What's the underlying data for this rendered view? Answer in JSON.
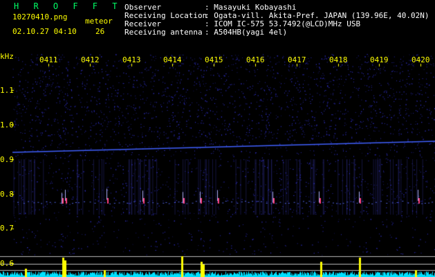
{
  "header": {
    "app_name": "H R O F F T",
    "filename": "10270410.png",
    "datetime": "02.10.27 04:10",
    "meteor_label": "meteor",
    "meteor_count": "26",
    "fields": [
      {
        "label": "Observer",
        "value": ": Masayuki Kobayashi"
      },
      {
        "label": "Receiving Location",
        "value": ": Ogata-vill. Akita-Pref. JAPAN (139.96E, 40.02N)"
      },
      {
        "label": "Receiver",
        "value": ": ICOM IC-575 53.7492(@LCD)MHz USB"
      },
      {
        "label": "Receiving antenna",
        "value": ": A504HB(yagi 4el)"
      }
    ]
  },
  "axis": {
    "unit": "kHz",
    "y_labels": [
      "1.1",
      "1.0",
      "0.9",
      "0.8",
      "0.7",
      "0.6"
    ],
    "time_labels": [
      "0411",
      "0412",
      "0413",
      "0414",
      "0415",
      "0416",
      "0417",
      "0418",
      "0419",
      "0420"
    ]
  },
  "colors": {
    "text": "#ffff00",
    "title": "#00ff66",
    "noise": "#2a2aa0",
    "carrier": "#4060ff",
    "meteor": "#ff4080",
    "bottom_trace": "#00e0ff",
    "bottom_peak": "#ffff00"
  }
}
